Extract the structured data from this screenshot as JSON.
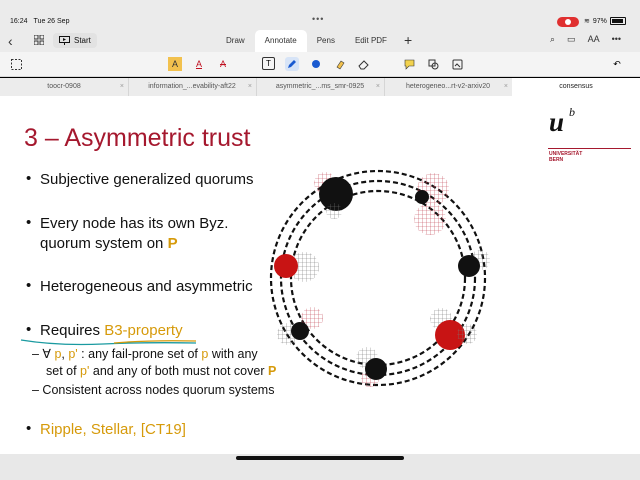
{
  "status": {
    "time": "16:24",
    "date": "Tue 26 Sep",
    "battery": "97%"
  },
  "nav": {
    "start_label": "Start",
    "tabs": [
      "Draw",
      "Annotate",
      "Pens",
      "Edit PDF"
    ],
    "active_tab": "Annotate"
  },
  "doc_tabs": [
    "toocr-0908",
    "information_...evability-aft22",
    "asymmetric_...ms_smr-0925",
    "heterogeneo...rt-v2-arxiv20",
    "consensus"
  ],
  "slide": {
    "title": "3 – Asymmetric trust",
    "logo": {
      "mark": "u",
      "superscript": "b",
      "line1": "UNIVERSITÄT",
      "line2": "BERN"
    },
    "bullets": [
      {
        "text": "Subjective generalized quorums"
      },
      {
        "line1": "Every node has its own Byz.",
        "line2_prefix": "quorum system on ",
        "line2_highlight": "P"
      },
      {
        "text": "Heterogeneous and asymmetric"
      },
      {
        "prefix": "Requires ",
        "highlight": "B3-property"
      },
      {
        "text": "Ripple, Stellar, [CT19]"
      }
    ],
    "sub_bullets": {
      "first_line_start": "– ∀ ",
      "p": "p",
      "sep": ", ",
      "p_prime": "p'",
      "first_line_mid": " : any fail-prone set of ",
      "first_line_end": " with any",
      "second_line_start": "set of ",
      "second_line_mid": " and any of both must not cover ",
      "P": "P",
      "third": "– Consistent across nodes quorum systems"
    }
  },
  "colors": {
    "title_red": "#a5182e",
    "highlight_gold": "#d69a0a",
    "node_red": "#c81414",
    "hatch_red": "#c04050"
  }
}
